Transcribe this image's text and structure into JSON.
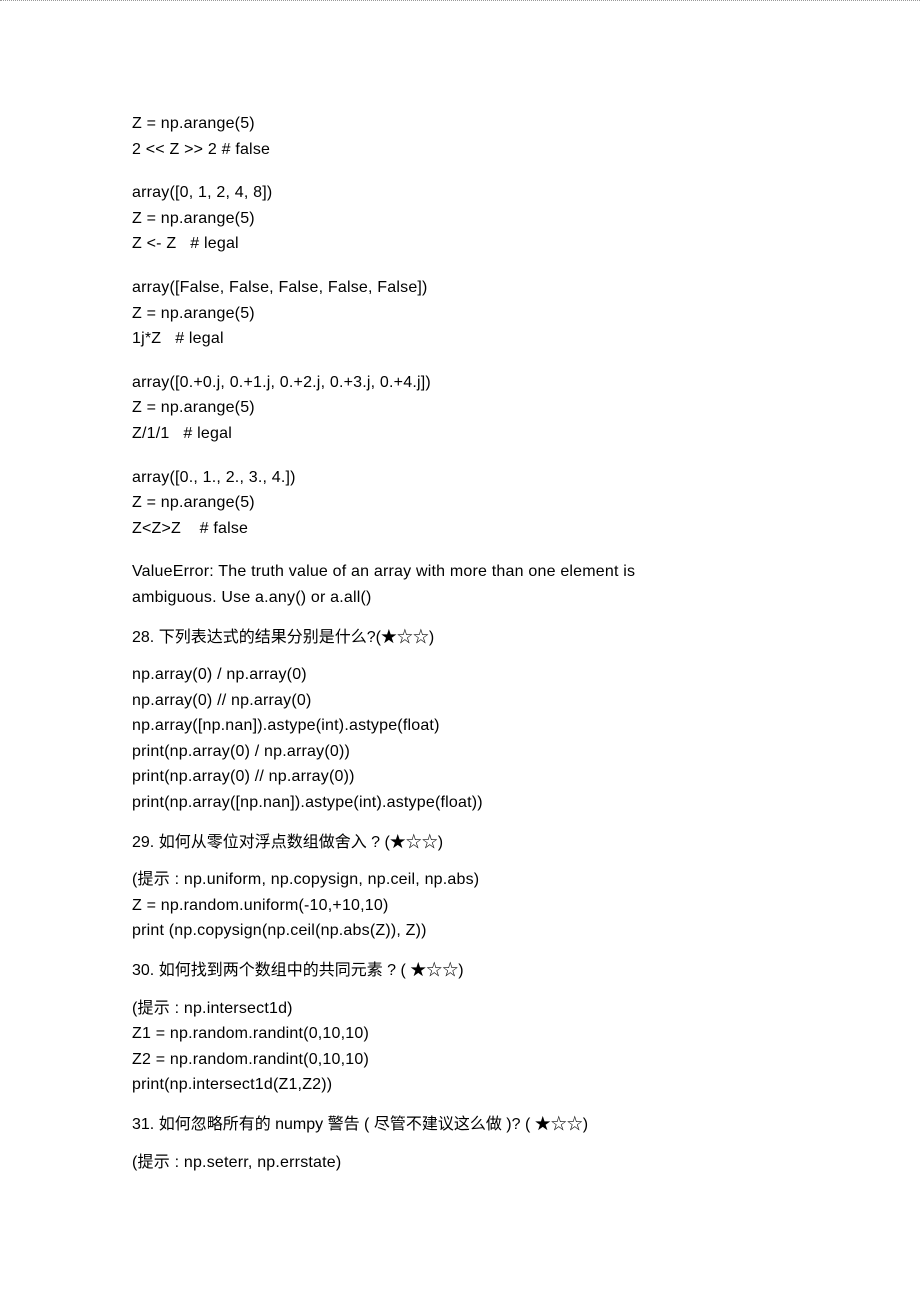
{
  "block1": {
    "l1": "Z = np.arange(5)",
    "l2": "2 << Z >> 2 # false"
  },
  "block2": {
    "l1": "array([0, 1, 2, 4, 8])",
    "l2": "Z = np.arange(5)",
    "l3": "Z <- Z   # legal"
  },
  "block3": {
    "l1": "array([False, False, False, False, False])",
    "l2": "Z = np.arange(5)",
    "l3": "1j*Z   # legal"
  },
  "block4": {
    "l1": "array([0.+0.j, 0.+1.j, 0.+2.j, 0.+3.j, 0.+4.j])",
    "l2": "Z = np.arange(5)",
    "l3": "Z/1/1   # legal"
  },
  "block5": {
    "l1": "array([0., 1., 2., 3., 4.])",
    "l2": "Z = np.arange(5)",
    "l3": "Z<Z>Z    # false"
  },
  "block6": {
    "l1": "ValueError: The truth value of an array with more than one element is",
    "l2": "ambiguous. Use a.any() or a.all()"
  },
  "q28": {
    "title": "28.  下列表达式的结果分别是什么?(★☆☆)",
    "l1": "np.array(0) / np.array(0)",
    "l2": "np.array(0) // np.array(0)",
    "l3": "np.array([np.nan]).astype(int).astype(float)",
    "l4": "print(np.array(0) / np.array(0))",
    "l5": "print(np.array(0) // np.array(0))",
    "l6": "print(np.array([np.nan]).astype(int).astype(float))"
  },
  "q29": {
    "title": "29.  如何从零位对浮点数组做舍入        ? (★☆☆)",
    "l1": "(提示 : np.uniform, np.copysign, np.ceil, np.abs)",
    "l2": "Z = np.random.uniform(-10,+10,10)",
    "l3": "print (np.copysign(np.ceil(np.abs(Z)), Z))"
  },
  "q30": {
    "title": "30.  如何找到两个数组中的共同元素       ? ( ★☆☆)",
    "l1": "(提示 : np.intersect1d)",
    "l2": "Z1 = np.random.randint(0,10,10)",
    "l3": "Z2 = np.random.randint(0,10,10)",
    "l4": "print(np.intersect1d(Z1,Z2))"
  },
  "q31": {
    "title": "31.  如何忽略所有的      numpy    警告  (  尽管不建议这么做   )? ( ★☆☆)",
    "l1": "(提示 : np.seterr, np.errstate)"
  }
}
